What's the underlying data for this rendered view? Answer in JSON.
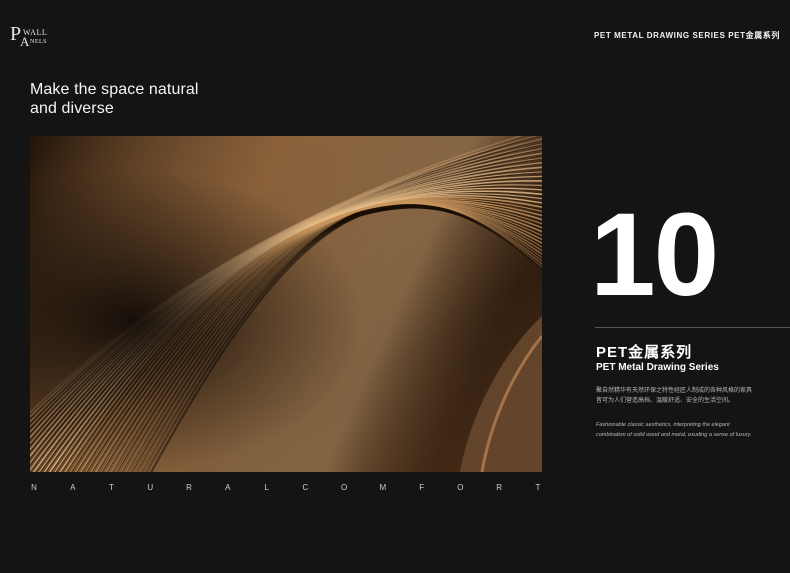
{
  "logo": {
    "letter_p": "P",
    "wall": "WALL",
    "letter_a": "A",
    "nels": "NELS"
  },
  "header": {
    "series_label": "PET METAL DRAWING SERIES PET金属系列"
  },
  "headline": {
    "line1": "Make the space natural",
    "line2": "and diverse"
  },
  "photo": {
    "description_icon": "metal-wave-photo",
    "colors": {
      "base": "#2a1a0e",
      "highlight": "#d9a56a",
      "shadow": "#1a0f06"
    }
  },
  "spaced_word": [
    "N",
    "A",
    "T",
    "U",
    "R",
    "A",
    "L",
    "C",
    "O",
    "M",
    "F",
    "O",
    "R",
    "T"
  ],
  "number": "10",
  "series": {
    "cn": "PET金属系列",
    "en": "PET Metal Drawing Series",
    "desc_cn": "聚自然精华有天然环保之特性经匠人制成的各种风格的家具皆可为人们营造高档、温暖舒适、安全的生活空间。",
    "desc_en": "Fashionable classic aesthetics, interpreting the elegant combination of solid wood and metal, exuding a sense of luxury."
  }
}
